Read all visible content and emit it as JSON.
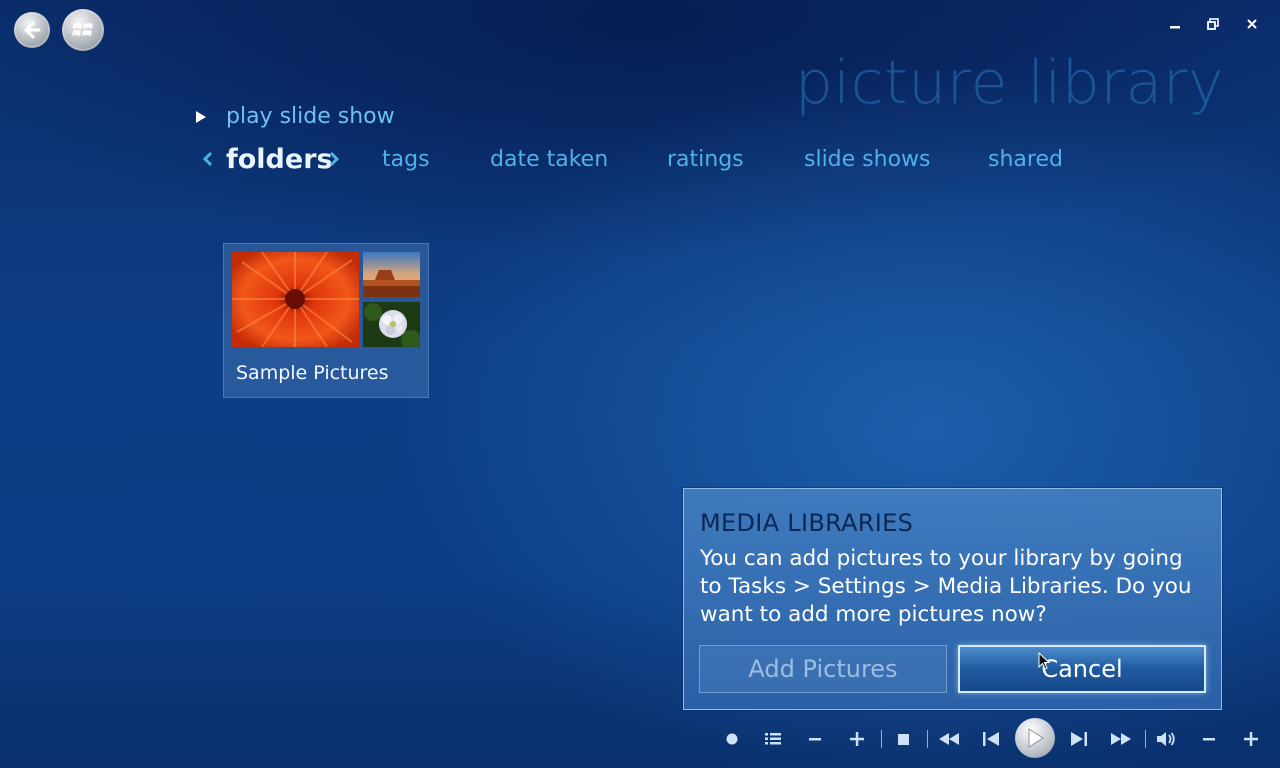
{
  "header": {
    "page_title": "picture library"
  },
  "actions": {
    "play_slide_show": "play slide show"
  },
  "nav": {
    "current": "folders",
    "items": [
      "tags",
      "date taken",
      "ratings",
      "slide shows",
      "shared"
    ]
  },
  "library": {
    "folders": [
      {
        "label": "Sample Pictures"
      }
    ]
  },
  "dialog": {
    "title": "MEDIA LIBRARIES",
    "message": "You can add pictures to your library by going to Tasks > Settings > Media Libraries. Do you want to add more pictures now?",
    "add_button": "Add Pictures",
    "cancel_button": "Cancel"
  },
  "icons": {
    "back": "back-arrow-icon",
    "start": "windows-start-icon",
    "minimize": "minimize-icon",
    "restore": "restore-icon",
    "close": "close-icon"
  },
  "colors": {
    "accent": "#4fb0ea",
    "background": "#0c3d84"
  }
}
